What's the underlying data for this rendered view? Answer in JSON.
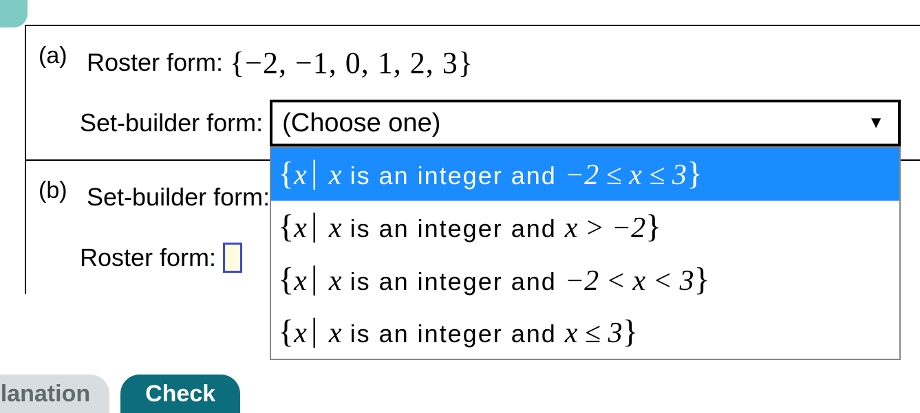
{
  "partA": {
    "label": "(a)",
    "rosterLabel": "Roster form:",
    "rosterValue": "{−2, −1, 0, 1, 2, 3}",
    "setBuilderLabel": "Set-builder form:",
    "dropdownPlaceholder": "(Choose one)",
    "options": [
      {
        "brace_l": "{",
        "x1": "x",
        "pipe": "|",
        "x2": "x",
        "txt": " is an integer and ",
        "cond": "−2 ≤ x ≤ 3",
        "brace_r": "}",
        "highlight": true
      },
      {
        "brace_l": "{",
        "x1": "x",
        "pipe": "|",
        "x2": "x",
        "txt": " is an integer and ",
        "cond": "x > −2",
        "brace_r": "}",
        "highlight": false
      },
      {
        "brace_l": "{",
        "x1": "x",
        "pipe": "|",
        "x2": "x",
        "txt": " is an integer and ",
        "cond": "−2 < x < 3",
        "brace_r": "}",
        "highlight": false
      },
      {
        "brace_l": "{",
        "x1": "x",
        "pipe": "|",
        "x2": "x",
        "txt": " is an integer and ",
        "cond": "x ≤ 3",
        "brace_r": "}",
        "highlight": false
      }
    ]
  },
  "partB": {
    "label": "(b)",
    "setBuilderLabel": "Set-builder form:",
    "rosterLabel": "Roster form:"
  },
  "buttons": {
    "explanation": "planation",
    "check": "Check"
  }
}
